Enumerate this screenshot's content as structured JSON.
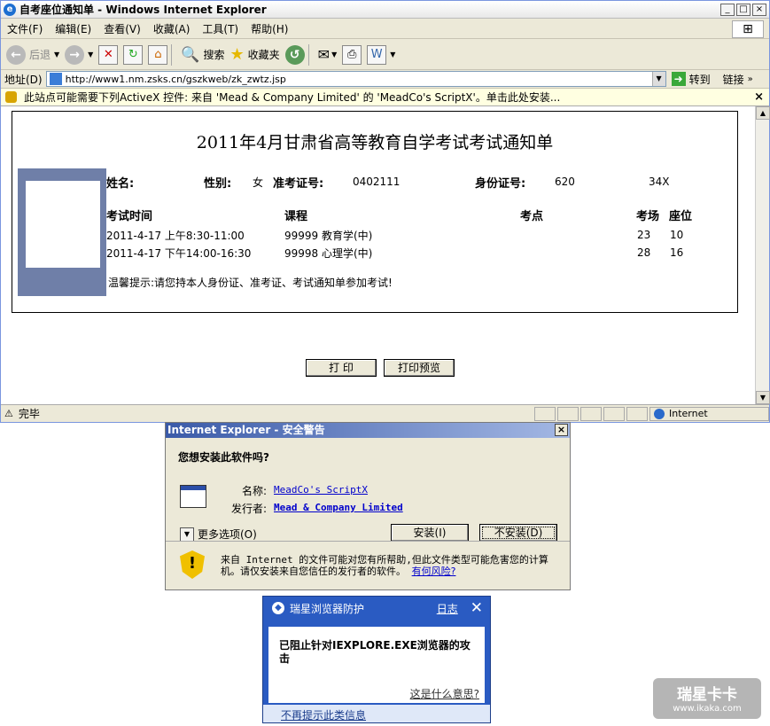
{
  "ie": {
    "title": "自考座位通知单 - Windows Internet Explorer",
    "menu": [
      "文件(F)",
      "编辑(E)",
      "查看(V)",
      "收藏(A)",
      "工具(T)",
      "帮助(H)"
    ],
    "toolbar": {
      "back": "后退",
      "search": "搜索",
      "favorites": "收藏夹"
    },
    "address_label": "地址(D)",
    "address": "http://www1.nm.zsks.cn/gszkweb/zk_zwtz.jsp",
    "go": "转到",
    "links": "链接",
    "infobar": "此站点可能需要下列ActiveX 控件: 来自 'Mead & Company Limited' 的 'MeadCo's ScriptX'。单击此处安装...",
    "status": "完毕",
    "zone": "Internet"
  },
  "notice": {
    "title": "2011年4月甘肃省高等教育自学考试考试通知单",
    "name_label": "姓名:",
    "gender_label": "性别:",
    "gender": "女",
    "ticket_label": "准考证号:",
    "ticket": "0402111",
    "id_label": "身份证号:",
    "id_start": "620",
    "id_end": "34X",
    "headers": [
      "考试时间",
      "课程",
      "考点",
      "考场",
      "座位"
    ],
    "rows": [
      {
        "time": "2011-4-17 上午8:30-11:00",
        "course": "99999 教育学(中)",
        "room": "23",
        "seat": "10"
      },
      {
        "time": "2011-4-17 下午14:00-16:30",
        "course": "99998 心理学(中)",
        "room": "28",
        "seat": "16"
      }
    ],
    "hint": "温馨提示:请您持本人身份证、准考证、考试通知单参加考试!",
    "print": "打  印",
    "preview": "打印预览"
  },
  "security": {
    "title": "Internet Explorer - 安全警告",
    "question": "您想安装此软件吗?",
    "name_label": "名称:",
    "name": "MeadCo's ScriptX",
    "publisher_label": "发行者:",
    "publisher": "Mead & Company Limited",
    "more": "更多选项(O)",
    "install": "安装(I)",
    "dont_install": "不安装(D)",
    "warning": "来自 Internet 的文件可能对您有所帮助,但此文件类型可能危害您的计算机。请仅安装来自您信任的发行者的软件。",
    "risk": "有何风险?"
  },
  "ruixing": {
    "title": "瑞星浏览器防护",
    "log": "日志",
    "message": "已阻止针对IEXPLORE.EXE浏览器的攻击",
    "what": "这是什么意思?",
    "no_more": "不再提示此类信息"
  },
  "watermark": {
    "brand": "瑞星卡卡",
    "site": "www.ikaka.com"
  }
}
